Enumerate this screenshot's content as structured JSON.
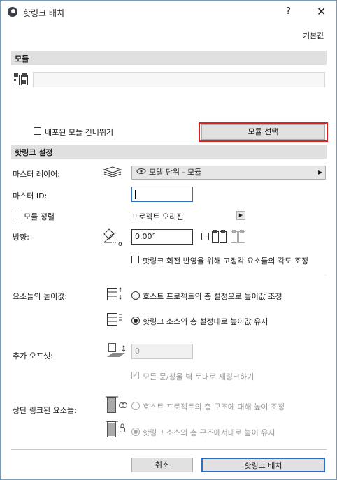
{
  "window": {
    "title": "핫링크 배치",
    "help": "?",
    "close": "✕"
  },
  "defaults_label": "기본값",
  "module_section": {
    "title": "모듈",
    "path_value": "",
    "skip_nested_label": "내포된 모듈 건너뛰기",
    "skip_nested_checked": false,
    "select_button": "모듈 선택"
  },
  "hotlink_settings": {
    "title": "핫링크 설정",
    "master_layer_label": "마스터 레이어:",
    "master_layer_value": "모델 단위 - 모듈",
    "master_id_label": "마스터 ID:",
    "master_id_value": "",
    "align_module_label": "모듈 정렬",
    "align_module_checked": false,
    "origin_label": "프로젝트 오리진",
    "orientation_label": "방향:",
    "orientation_value": "0.00°",
    "mirror_checked": false,
    "adjust_angle_label": "핫링크 회전 반영을 위해 고정각 요소들의 각도 조정",
    "adjust_angle_checked": false
  },
  "elevation": {
    "label": "요소들의 높이값:",
    "option_host": "호스트 프로젝트의 층 설정으로 높이값 조정",
    "option_source": "핫링크 소스의 층 설정대로 높이값 유지",
    "selected": "source"
  },
  "offset": {
    "label": "추가 오프셋:",
    "value": "0",
    "relink_label": "모든 문/창을 벽 토대로 재링크하기",
    "relink_checked": true
  },
  "top_linked": {
    "label": "상단 링크된 요소들:",
    "option_host": "호스트 프로젝트의 층 구조에 대해 높이 조정",
    "option_source": "핫링크 소스의 층 구조에서대로 높이 유지",
    "selected": "source"
  },
  "footer": {
    "cancel": "취소",
    "place": "핫링크 배치"
  },
  "colors": {
    "highlight": "#e02020",
    "section_bg": "#e0e0e0",
    "field_focus": "#2f6fc2"
  }
}
